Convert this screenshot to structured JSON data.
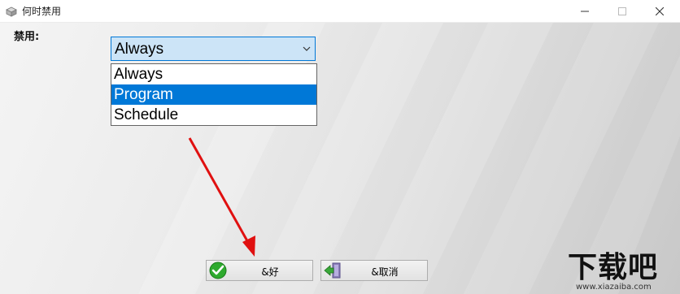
{
  "window": {
    "title": "何时禁用",
    "controls": [
      "minimize-icon",
      "maximize-icon",
      "close-icon"
    ]
  },
  "form": {
    "label": "禁用:",
    "combo": {
      "value": "Always",
      "options": [
        "Always",
        "Program",
        "Schedule"
      ],
      "highlighted": "Program"
    }
  },
  "buttons": {
    "ok": "&好",
    "cancel": "&取消"
  },
  "watermark": {
    "text": "下载吧",
    "url": "www.xiazaiba.com"
  },
  "colors": {
    "selection": "#0078d7",
    "combo_bg": "#cce4f7",
    "arrow": "#e01010"
  }
}
